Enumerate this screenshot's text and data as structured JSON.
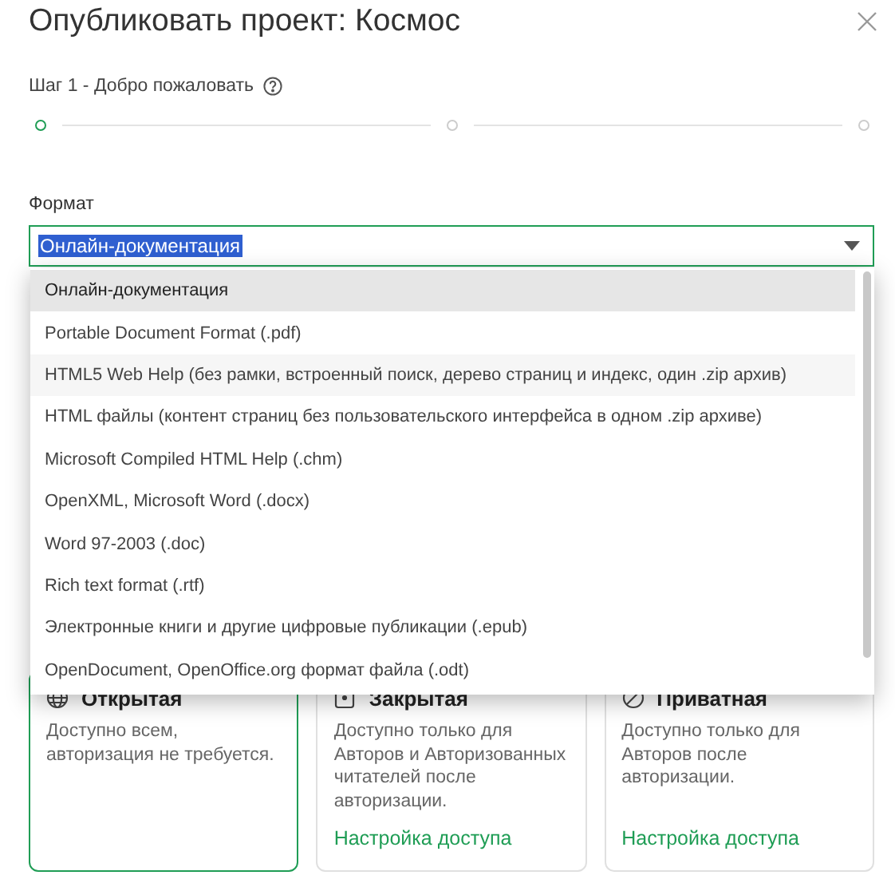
{
  "dialog": {
    "title": "Опубликовать проект: Космос"
  },
  "step": {
    "label": "Шаг 1 - Добро пожаловать"
  },
  "stepper": [
    {
      "selected": true
    },
    {
      "selected": false
    },
    {
      "selected": false
    }
  ],
  "format": {
    "label": "Формат",
    "value": "Онлайн-документация",
    "value_highlighted": true,
    "expanded": true,
    "options": [
      {
        "label": "Онлайн-документация",
        "selected": true,
        "hovered": false
      },
      {
        "label": "Portable Document Format (.pdf)",
        "selected": false,
        "hovered": false
      },
      {
        "label": "HTML5 Web Help (без рамки, встроенный поиск, дерево страниц и индекс, один .zip архив)",
        "selected": false,
        "hovered": true
      },
      {
        "label": "HTML файлы (контент страниц без пользовательского интерфейса в одном .zip архиве)",
        "selected": false,
        "hovered": false
      },
      {
        "label": "Microsoft Compiled HTML Help (.chm)",
        "selected": false,
        "hovered": false
      },
      {
        "label": "OpenXML, Microsoft Word (.docx)",
        "selected": false,
        "hovered": false
      },
      {
        "label": "Word 97-2003 (.doc)",
        "selected": false,
        "hovered": false
      },
      {
        "label": "Rich text format (.rtf)",
        "selected": false,
        "hovered": false
      },
      {
        "label": "Электронные книги и другие цифровые публикации (.epub)",
        "selected": false,
        "hovered": false
      },
      {
        "label": "OpenDocument, OpenOffice.org формат файла (.odt)",
        "selected": false,
        "hovered": false
      }
    ]
  },
  "access_cards": [
    {
      "title": "Открытая",
      "description": "Доступно всем, авторизация не требуется.",
      "selected": true
    },
    {
      "title": "Закрытая",
      "description": "Доступно только для Авторов и Авторизованных читателей после авторизации.",
      "link": "Настройка доступа",
      "selected": false
    },
    {
      "title": "Приватная",
      "description": "Доступно только для Авторов после авторизации.",
      "link": "Настройка доступа",
      "selected": false
    }
  ]
}
